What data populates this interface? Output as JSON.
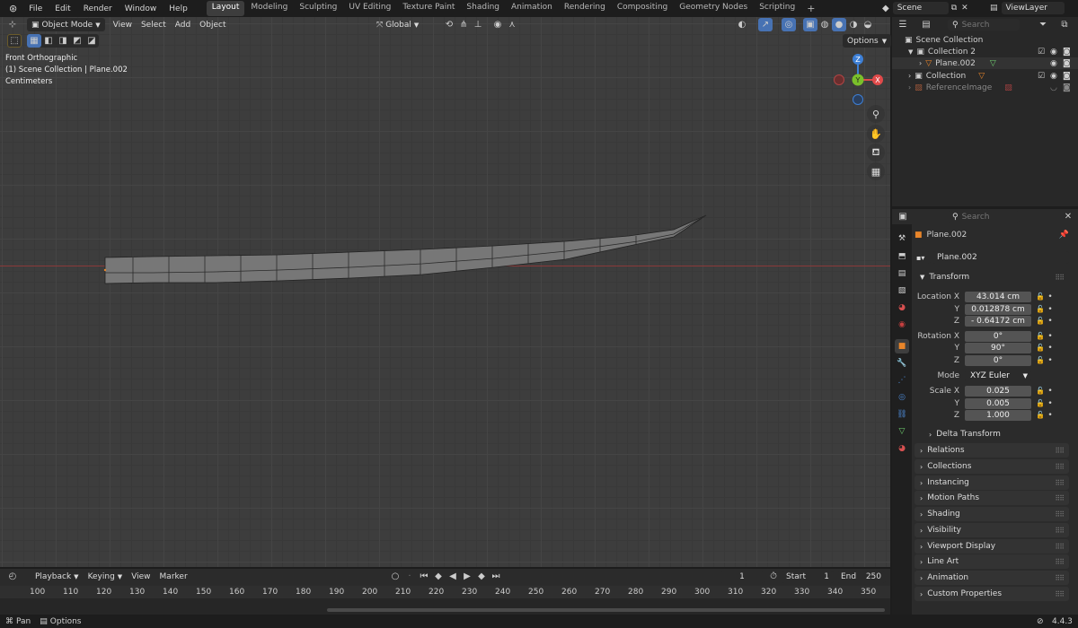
{
  "menu": [
    "File",
    "Edit",
    "Render",
    "Window",
    "Help"
  ],
  "workspaces": [
    "Layout",
    "Modeling",
    "Sculpting",
    "UV Editing",
    "Texture Paint",
    "Shading",
    "Animation",
    "Rendering",
    "Compositing",
    "Geometry Nodes",
    "Scripting"
  ],
  "active_workspace": "Layout",
  "add_workspace": "+",
  "scene": "Scene",
  "view_layer": "ViewLayer",
  "viewport": {
    "mode": "Object Mode",
    "menus": [
      "View",
      "Select",
      "Add",
      "Object"
    ],
    "transform_orientation": "Global",
    "options": "Options",
    "overlay_view": "Front Orthographic",
    "overlay_collection": "(1) Scene Collection | Plane.002",
    "overlay_units": "Centimeters",
    "gizmo": {
      "z": "Z",
      "y": "Y",
      "x": "X"
    }
  },
  "outliner": {
    "search_placeholder": "Search",
    "root": "Scene Collection",
    "items": [
      {
        "label": "Collection 2"
      },
      {
        "label": "Plane.002"
      },
      {
        "label": "Collection"
      },
      {
        "label": "ReferenceImage"
      }
    ]
  },
  "properties": {
    "search_placeholder": "Search",
    "object_name": "Plane.002",
    "data_name": "Plane.002",
    "transform_header": "Transform",
    "location_label": "Location X",
    "location": [
      "43.014 cm",
      "0.012878 cm",
      "- 0.64172 cm"
    ],
    "rotation_label": "Rotation X",
    "rotation": [
      "0°",
      "90°",
      "0°"
    ],
    "mode_label": "Mode",
    "mode_value": "XYZ Euler",
    "scale_label": "Scale X",
    "scale": [
      "0.025",
      "0.005",
      "1.000"
    ],
    "axis_y": "Y",
    "axis_z": "Z",
    "delta_transform": "Delta Transform",
    "panels": [
      "Relations",
      "Collections",
      "Instancing",
      "Motion Paths",
      "Shading",
      "Visibility",
      "Viewport Display",
      "Line Art",
      "Animation",
      "Custom Properties"
    ]
  },
  "timeline": {
    "menus": [
      "Playback",
      "Keying",
      "View",
      "Marker"
    ],
    "current_frame": "1",
    "start_label": "Start",
    "start": "1",
    "end_label": "End",
    "end": "250",
    "ticks": [
      "100",
      "110",
      "120",
      "130",
      "140",
      "150",
      "160",
      "170",
      "180",
      "190",
      "200",
      "210",
      "220",
      "230",
      "240",
      "250",
      "260",
      "270",
      "280",
      "290",
      "300",
      "310",
      "320",
      "330",
      "340",
      "350"
    ]
  },
  "status": {
    "pan": "Pan",
    "options": "Options",
    "version": "4.4.3"
  },
  "colors": {
    "accent": "#4772b3",
    "x_axis": "#e04a4a",
    "y_axis": "#7ac02a",
    "z_axis": "#3d7fd6",
    "object_orange": "#e8852a"
  }
}
